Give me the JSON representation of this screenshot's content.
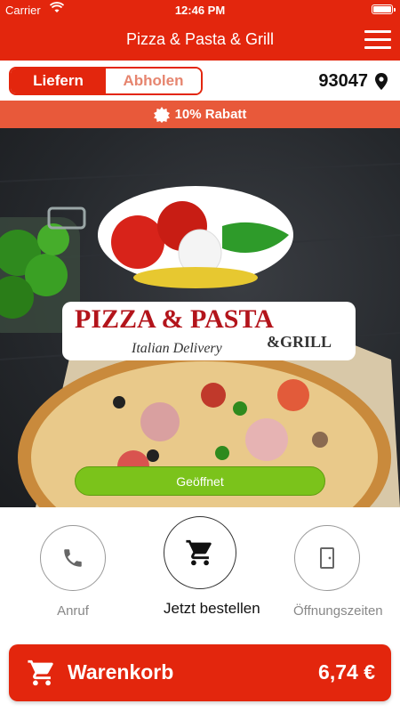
{
  "status_bar": {
    "carrier": "Carrier",
    "time": "12:46 PM"
  },
  "navbar": {
    "title": "Pizza & Pasta & Grill",
    "menu_icon": "hamburger-icon"
  },
  "order_mode": {
    "options": [
      "Liefern",
      "Abholen"
    ],
    "selected": "Liefern"
  },
  "location": {
    "zip": "93047",
    "icon": "location-pin-icon"
  },
  "discount": {
    "text": "10% Rabatt",
    "icon": "badge-icon"
  },
  "hero": {
    "logo": {
      "line1": "PIZZA & PASTA",
      "line2": "Italian Delivery",
      "line3": "&GRILL"
    },
    "open_status": "Geöffnet",
    "open_color": "#7bc31b"
  },
  "actions": [
    {
      "label": "Anruf",
      "icon": "phone-icon"
    },
    {
      "label": "Jetzt bestellen",
      "icon": "cart-icon"
    },
    {
      "label": "Öffnungszeiten",
      "icon": "door-icon"
    }
  ],
  "cart": {
    "label": "Warenkorb",
    "total": "6,74 €",
    "icon": "cart-icon"
  },
  "colors": {
    "brand": "#e3260d",
    "discount": "#e8593a",
    "open": "#7bc31b"
  }
}
